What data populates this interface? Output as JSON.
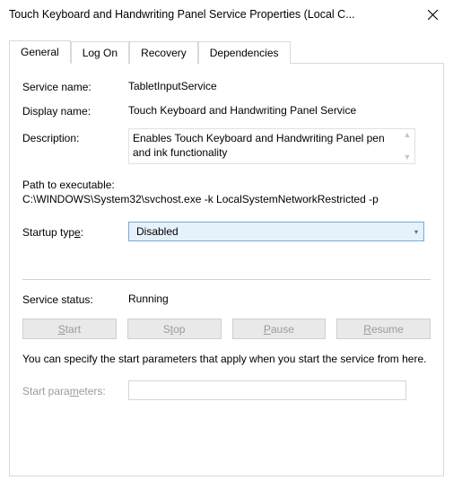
{
  "window": {
    "title": "Touch Keyboard and Handwriting Panel Service Properties (Local C..."
  },
  "tabs": {
    "general": "General",
    "logon": "Log On",
    "recovery": "Recovery",
    "dependencies": "Dependencies"
  },
  "general": {
    "service_name_label": "Service name:",
    "service_name_value": "TabletInputService",
    "display_name_label": "Display name:",
    "display_name_value": "Touch Keyboard and Handwriting Panel Service",
    "description_label": "Description:",
    "description_value": "Enables Touch Keyboard and Handwriting Panel pen and ink functionality",
    "path_label": "Path to executable:",
    "path_value": "C:\\WINDOWS\\System32\\svchost.exe -k LocalSystemNetworkRestricted -p",
    "startup_type_label_pre": "Startup typ",
    "startup_type_label_ul": "e",
    "startup_type_label_post": ":",
    "startup_type_value": "Disabled",
    "service_status_label": "Service status:",
    "service_status_value": "Running",
    "start_btn_pre": "",
    "start_btn_ul": "S",
    "start_btn_post": "tart",
    "stop_btn_pre": "S",
    "stop_btn_ul": "t",
    "stop_btn_post": "op",
    "pause_btn_pre": "",
    "pause_btn_ul": "P",
    "pause_btn_post": "ause",
    "resume_btn_pre": "",
    "resume_btn_ul": "R",
    "resume_btn_post": "esume",
    "note": "You can specify the start parameters that apply when you start the service from here.",
    "start_params_label_pre": "Start para",
    "start_params_label_ul": "m",
    "start_params_label_post": "eters:",
    "start_params_value": ""
  }
}
